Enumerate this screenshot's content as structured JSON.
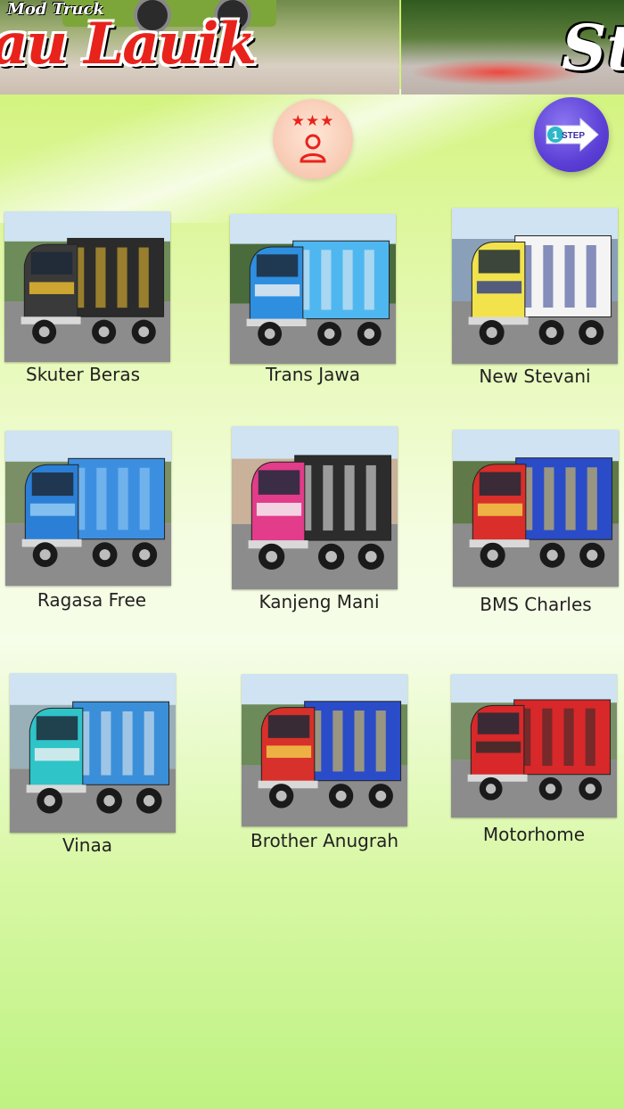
{
  "banner": {
    "mod_truck_text": "Mod Truck",
    "left_title": "au Lauik",
    "right_title": "St"
  },
  "toolbar": {
    "rate_stars": "★★★",
    "next_step_number": "1",
    "next_step_label": "STEP"
  },
  "colors": {
    "accent_red": "#e8231c",
    "step_purple": "#5b3fd6"
  },
  "items": [
    {
      "label": "Skuter Beras",
      "cab": "#3a3a3a",
      "box": "#2b2b2b",
      "accent": "#f2c230",
      "bg": "#6e8b5a"
    },
    {
      "label": "Trans Jawa",
      "cab": "#2e8fe0",
      "box": "#4fb7f0",
      "accent": "#f2f2f2",
      "bg": "#4a6b3c"
    },
    {
      "label": "New Stevani",
      "cab": "#f2e34c",
      "box": "#f4f4f4",
      "accent": "#2a3a8a",
      "bg": "#8aa0b8"
    },
    {
      "label": "Ragasa Free",
      "cab": "#2b7fd6",
      "box": "#3c8fe0",
      "accent": "#9ad0f5",
      "bg": "#7a8f66"
    },
    {
      "label": "Kanjeng Mani",
      "cab": "#e23c8a",
      "box": "#2c2c2c",
      "accent": "#f7f7f7",
      "bg": "#c9b19a"
    },
    {
      "label": "BMS Charles",
      "cab": "#d92e2a",
      "box": "#2a4cc8",
      "accent": "#f2d24a",
      "bg": "#5f7a48"
    },
    {
      "label": "Vinaa",
      "cab": "#2ec4c8",
      "box": "#3a8fd8",
      "accent": "#f2f2f2",
      "bg": "#9ab0b8"
    },
    {
      "label": "Brother Anugrah",
      "cab": "#d8302a",
      "box": "#2a4cc8",
      "accent": "#f2d24a",
      "bg": "#6c8a5a"
    },
    {
      "label": "Motorhome",
      "cab": "#d8282a",
      "box": "#d8282a",
      "accent": "#2a2a2a",
      "bg": "#7a9068"
    }
  ]
}
